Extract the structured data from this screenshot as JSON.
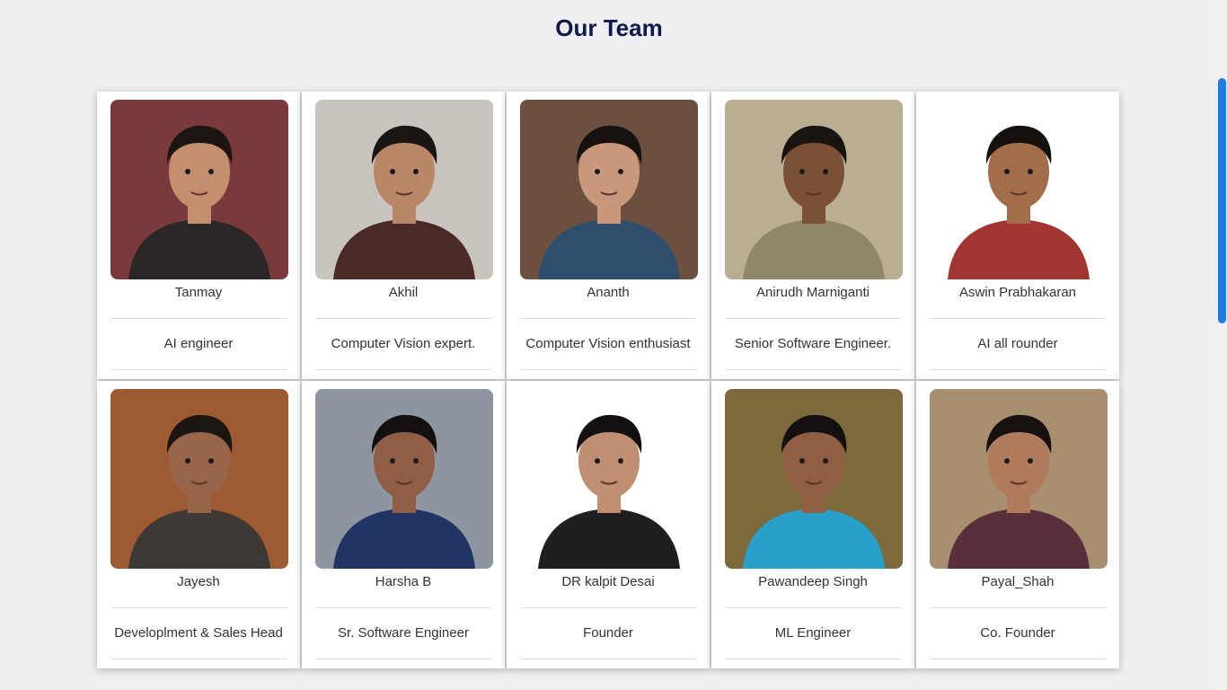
{
  "page": {
    "title": "Our Team"
  },
  "team": [
    {
      "name": "Tanmay",
      "role": "AI engineer",
      "bg": "#7a3a3c",
      "skin": "#c48e6f",
      "hair": "#1d1512",
      "shirt": "#2b2726",
      "icon": "person-photo-icon"
    },
    {
      "name": "Akhil",
      "role": "Computer Vision expert.",
      "bg": "#c9c4bd",
      "skin": "#b98767",
      "hair": "#1b1614",
      "shirt": "#4a2a26",
      "icon": "person-photo-icon"
    },
    {
      "name": "Ananth",
      "role": "Computer Vision enthusiast",
      "bg": "#6b5040",
      "skin": "#c8977c",
      "hair": "#17120f",
      "shirt": "#2f4e6e",
      "icon": "person-photo-icon"
    },
    {
      "name": "Anirudh Marniganti",
      "role": "Senior Software Engineer.",
      "bg": "#b9ad92",
      "skin": "#7b5136",
      "hair": "#1a1410",
      "shirt": "#8f8769",
      "icon": "person-photo-icon"
    },
    {
      "name": "Aswin Prabhakaran",
      "role": "AI all rounder",
      "bg": "#ffffff",
      "skin": "#a36c4b",
      "hair": "#15100d",
      "shirt": "#a23532",
      "icon": "person-photo-icon"
    },
    {
      "name": "Jayesh",
      "role": "Developlment & Sales Head",
      "bg": "#9e5a31",
      "skin": "#996548",
      "hair": "#1c1612",
      "shirt": "#3e3935",
      "icon": "person-photo-icon"
    },
    {
      "name": "Harsha B",
      "role": "Sr. Software Engineer",
      "bg": "#8d96a0",
      "skin": "#8f5e45",
      "hair": "#141010",
      "shirt": "#203564",
      "icon": "person-photo-icon"
    },
    {
      "name": "DR kalpit Desai",
      "role": "Founder",
      "bg": "#ffffff",
      "skin": "#c08e72",
      "hair": "#141012",
      "shirt": "#1f1f22",
      "icon": "person-photo-icon"
    },
    {
      "name": "Pawandeep Singh",
      "role": "ML Engineer",
      "bg": "#7c6a3d",
      "skin": "#8f5e43",
      "hair": "#151010",
      "shirt": "#28a0c9",
      "icon": "person-photo-icon"
    },
    {
      "name": "Payal_Shah",
      "role": "Co. Founder",
      "bg": "#a88f70",
      "skin": "#b07a5c",
      "hair": "#17110f",
      "shirt": "#5a2f3c",
      "icon": "person-photo-icon"
    }
  ]
}
